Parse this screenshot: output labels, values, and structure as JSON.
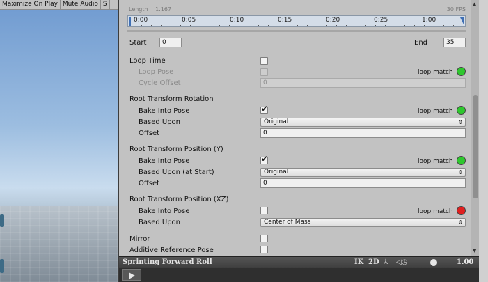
{
  "game_view": {
    "toolbar": [
      "Maximize On Play",
      "Mute Audio",
      "S"
    ]
  },
  "timeline": {
    "length_label": "Length",
    "length_value": "1.167",
    "fps": "30 FPS",
    "ticks": [
      "0:00",
      "0:05",
      "0:10",
      "0:15",
      "0:20",
      "0:25",
      "1:00"
    ]
  },
  "range": {
    "start_label": "Start",
    "start_value": "0",
    "end_label": "End",
    "end_value": "35"
  },
  "loop_time": {
    "label": "Loop Time",
    "loop_pose_label": "Loop Pose",
    "loop_match_label": "loop match",
    "loop_match_color": "#2ec72e",
    "cycle_offset_label": "Cycle Offset",
    "cycle_offset_value": "0"
  },
  "root_rotation": {
    "header": "Root Transform Rotation",
    "bake_label": "Bake Into Pose",
    "loop_match_label": "loop match",
    "loop_match_color": "#2ec72e",
    "based_upon_label": "Based Upon",
    "based_upon_value": "Original",
    "offset_label": "Offset",
    "offset_value": "0"
  },
  "root_position_y": {
    "header": "Root Transform Position (Y)",
    "bake_label": "Bake Into Pose",
    "loop_match_label": "loop match",
    "loop_match_color": "#2ec72e",
    "based_upon_label": "Based Upon (at Start)",
    "based_upon_value": "Original",
    "offset_label": "Offset",
    "offset_value": "0"
  },
  "root_position_xz": {
    "header": "Root Transform Position (XZ)",
    "bake_label": "Bake Into Pose",
    "loop_match_label": "loop match",
    "loop_match_color": "#e02020",
    "based_upon_label": "Based Upon",
    "based_upon_value": "Center of Mass"
  },
  "misc": {
    "mirror_label": "Mirror",
    "additive_label": "Additive Reference Pose"
  },
  "preview": {
    "clip_name": "Sprinting Forward Roll",
    "ik_label": "IK",
    "twod_label": "2D",
    "speed": "1.00"
  }
}
